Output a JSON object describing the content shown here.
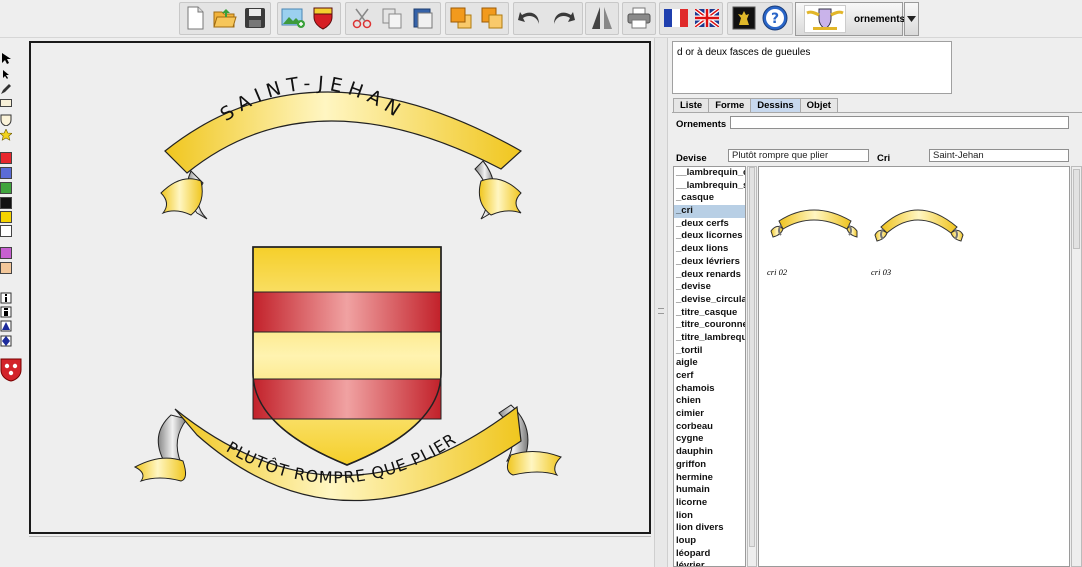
{
  "toolbar": {
    "buttons": [
      {
        "id": "new",
        "icon": "new-document-icon"
      },
      {
        "id": "open",
        "icon": "open-folder-icon"
      },
      {
        "id": "save",
        "icon": "save-disk-icon"
      },
      {
        "id": "insert-image",
        "icon": "insert-image-icon"
      },
      {
        "id": "shield",
        "icon": "shield-icon"
      },
      {
        "id": "cut",
        "icon": "scissors-icon"
      },
      {
        "id": "copy",
        "icon": "copy-icon"
      },
      {
        "id": "paste",
        "icon": "paste-icon"
      },
      {
        "id": "bring-front",
        "icon": "bring-front-icon"
      },
      {
        "id": "send-back",
        "icon": "send-back-icon"
      },
      {
        "id": "undo",
        "icon": "undo-icon"
      },
      {
        "id": "redo",
        "icon": "redo-icon"
      },
      {
        "id": "perspective",
        "icon": "perspective-icon"
      },
      {
        "id": "print",
        "icon": "printer-icon"
      },
      {
        "id": "lang-fr",
        "icon": "french-flag-icon"
      },
      {
        "id": "lang-en",
        "icon": "uk-flag-icon"
      },
      {
        "id": "heraldry",
        "icon": "heraldic-lion-icon"
      },
      {
        "id": "help",
        "icon": "help-icon"
      }
    ],
    "ornements_label": "ornements"
  },
  "palette": {
    "tools": [
      "arrow-tool-icon",
      "pointer-tool-icon",
      "pen-tool-icon",
      "rectangle-tool-icon",
      "shield-outline-icon",
      "star-tool-icon"
    ],
    "colors": [
      "#e8272d",
      "#5b6cd6",
      "#3fa43d",
      "#111111",
      "#f5d300",
      "#ffffff",
      "#c760d1",
      "#f3c79a"
    ],
    "bottom_tools": [
      "info-icon",
      "info-dark-icon",
      "triangle-icon",
      "diamond-icon",
      "coat-of-arms-icon"
    ]
  },
  "canvas": {
    "cri_text": "SAINT-JEHAN",
    "devise_text": "PLUTÔT ROMPRE QUE PLIER",
    "shield": {
      "field_color": "#f2d23a",
      "fesse_color": "#c9262e"
    }
  },
  "blazon": "d or à deux fasces de gueules",
  "tabs": [
    {
      "label": "Liste",
      "active": false
    },
    {
      "label": "Forme",
      "active": false
    },
    {
      "label": "Dessins",
      "active": true
    },
    {
      "label": "Objet",
      "active": false
    }
  ],
  "form": {
    "ornements_label": "Ornements",
    "ornements_value": "",
    "devise_label": "Devise",
    "devise_value": "Plutôt rompre que plier",
    "cri_label": "Cri",
    "cri_value": "Saint-Jehan"
  },
  "drawings_list": {
    "selected_index": 3,
    "items": [
      "__lambrequin_c",
      "__lambrequin_sc",
      "_casque",
      "_cri",
      "_deux cerfs",
      "_deux licornes",
      "_deux lions",
      "_deux lévriers",
      "_deux renards",
      "_devise",
      "_devise_circulaire",
      "_titre_casque",
      "_titre_couronne",
      "_titre_lambrequin",
      "_tortil",
      "aigle",
      "cerf",
      "chamois",
      "chien",
      "cimier",
      "corbeau",
      "cygne",
      "dauphin",
      "griffon",
      "hermine",
      "humain",
      "licorne",
      "lion",
      "lion divers",
      "loup",
      "léopard",
      "lévrier"
    ]
  },
  "gallery": {
    "items": [
      {
        "caption": "cri 02",
        "style": "flat"
      },
      {
        "caption": "cri 03",
        "style": "arched"
      }
    ]
  }
}
